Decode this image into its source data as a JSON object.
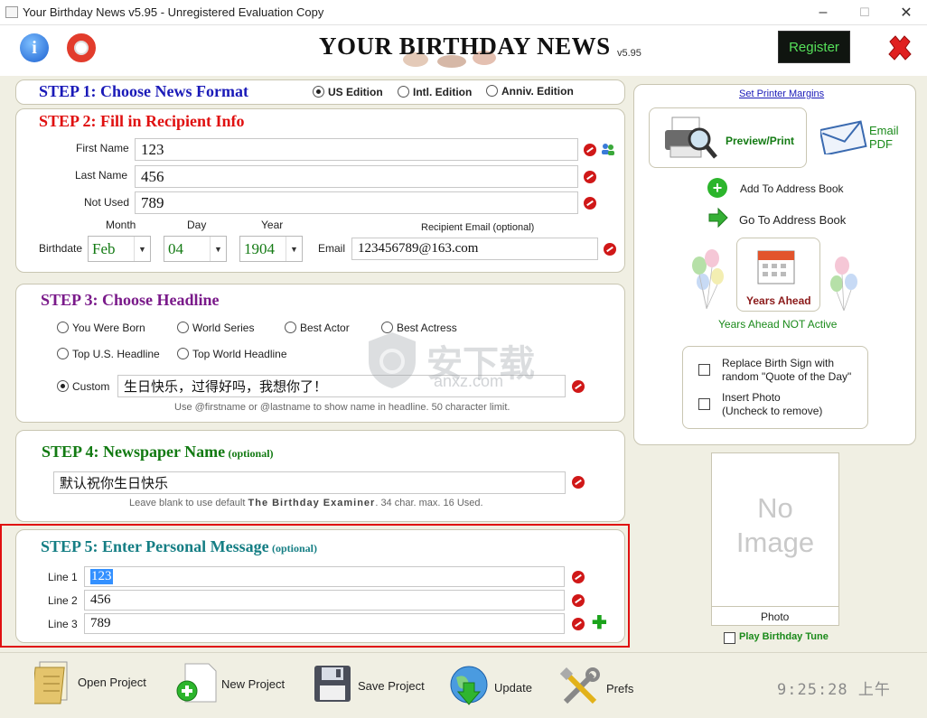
{
  "window": {
    "title": "Your Birthday News v5.95 - Unregistered Evaluation Copy",
    "minimize": "–",
    "maximize": "☐",
    "close": "✕"
  },
  "header": {
    "banner": "YOUR BIRTHDAY NEWS",
    "version": "v5.95",
    "register_label": "Register",
    "icons": [
      "info-icon",
      "help-lifebuoy-icon",
      "exit-x-icon"
    ]
  },
  "step1": {
    "title": "STEP 1: Choose News Format",
    "options": [
      "US Edition",
      "Intl. Edition",
      "Anniv. Edition"
    ],
    "selected": "US Edition"
  },
  "step2": {
    "title": "STEP 2: Fill in Recipient Info",
    "first_name_label": "First Name",
    "first_name": "123",
    "last_name_label": "Last Name",
    "last_name": "456",
    "not_used_label": "Not Used",
    "not_used": "789",
    "month_label": "Month",
    "day_label": "Day",
    "year_label": "Year",
    "birthdate_label": "Birthdate",
    "month": "Feb",
    "day": "04",
    "year": "1904",
    "email_header": "Recipient Email (optional)",
    "email_label": "Email",
    "email": "123456789@163.com"
  },
  "step3": {
    "title": "STEP 3: Choose Headline",
    "options": [
      "You Were Born",
      "World Series",
      "Best Actor",
      "Best Actress",
      "Top U.S. Headline",
      "Top World Headline"
    ],
    "custom_label": "Custom",
    "custom_value": "生日快乐，过得好吗，我想你了！",
    "hint": "Use @firstname or @lastname to show name in headline. 50 character limit."
  },
  "step4": {
    "title": "STEP 4: Newspaper Name",
    "optional": "(optional)",
    "value": "默认祝你生日快乐",
    "hint_pre": "Leave blank to use default",
    "hint_name": "The Birthday Examiner",
    "hint_post": ". 34 char. max. 16 Used."
  },
  "step5": {
    "title": "STEP 5: Enter Personal Message",
    "optional": "(optional)",
    "lines": [
      {
        "label": "Line 1",
        "value": "123"
      },
      {
        "label": "Line 2",
        "value": "456"
      },
      {
        "label": "Line 3",
        "value": "789"
      }
    ]
  },
  "right": {
    "printer_margins": "Set Printer Margins",
    "preview_print": "Preview/Print",
    "email_pdf_1": "Email",
    "email_pdf_2": "PDF",
    "add_address": "Add To Address Book",
    "go_address": "Go To Address Book",
    "years_ahead": "Years Ahead",
    "years_ahead_status": "Years Ahead NOT Active",
    "replace_sign_1": "Replace Birth Sign with",
    "replace_sign_2": "random \"Quote of the Day\"",
    "insert_photo_1": "Insert Photo",
    "insert_photo_2": "(Uncheck to remove)",
    "no_image_1": "No",
    "no_image_2": "Image",
    "photo_label": "Photo",
    "play_tune": "Play Birthday Tune"
  },
  "toolbar": {
    "open": "Open Project",
    "new": "New Project",
    "save": "Save Project",
    "update": "Update",
    "prefs": "Prefs",
    "clock": "9:25:28 上午"
  },
  "colors": {
    "step1": "#1a1ab8",
    "step2": "#e01010",
    "step3": "#7a1a8a",
    "step4": "#127a12",
    "step5": "#157e84",
    "highlight_border": "#e01010",
    "register_text": "#56e05a"
  }
}
